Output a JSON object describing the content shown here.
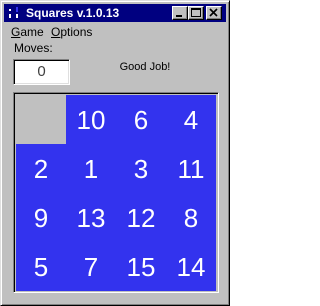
{
  "window": {
    "title": "Squares v.1.0.13",
    "icon": "squares-app-icon",
    "controls": [
      "minimize-icon",
      "maximize-icon",
      "close-icon"
    ]
  },
  "menu": {
    "items": [
      {
        "label": "Game",
        "accel": "G"
      },
      {
        "label": "Options",
        "accel": "O"
      }
    ]
  },
  "game": {
    "moves_label": "Moves:",
    "moves_value": "0",
    "status": "Good Job!",
    "tiles": [
      "",
      "10",
      "6",
      "4",
      "2",
      "1",
      "3",
      "11",
      "9",
      "13",
      "12",
      "8",
      "5",
      "7",
      "15",
      "14"
    ]
  },
  "colors": {
    "title_bar": "#000080",
    "tile": "#3333ee",
    "tile_text": "#ffffff",
    "empty_cell": "#c0c0c0",
    "window_face": "#c0c0c0"
  }
}
